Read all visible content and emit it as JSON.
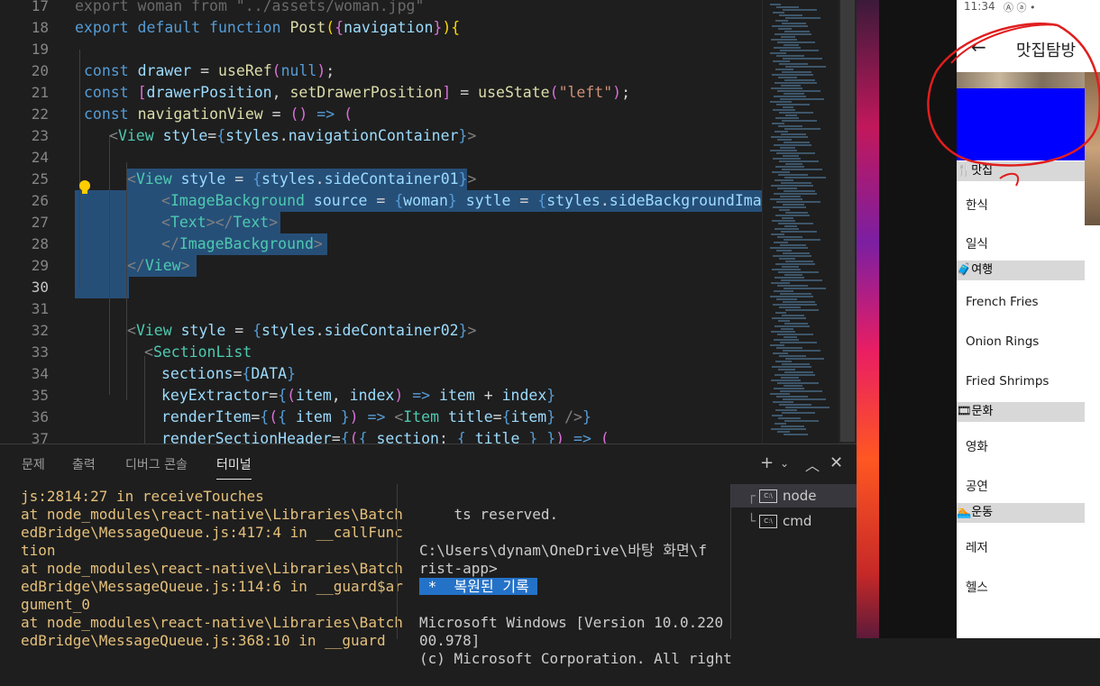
{
  "editor": {
    "line_numbers": [
      "17",
      "18",
      "19",
      "20",
      "21",
      "22",
      "23",
      "24",
      "25",
      "26",
      "27",
      "28",
      "29",
      "30",
      "31",
      "32",
      "33",
      "34",
      "35",
      "36",
      "37"
    ],
    "active_line": "30",
    "lines": {
      "l17": "export woman from \"../assets/woman.jpg\"",
      "l18": [
        [
          "export ",
          "kw"
        ],
        [
          "default ",
          "kw"
        ],
        [
          "function ",
          "kw"
        ],
        [
          "Post",
          "fn"
        ],
        [
          "(",
          "br"
        ],
        [
          "{",
          "br2"
        ],
        [
          "navigation",
          "var"
        ],
        [
          "}",
          "br2"
        ],
        [
          ")",
          "br"
        ],
        [
          "{",
          "br"
        ]
      ],
      "l20": [
        [
          "const ",
          "kw"
        ],
        [
          "drawer",
          "var"
        ],
        [
          " = ",
          ""
        ],
        [
          "useRef",
          "fn"
        ],
        [
          "(",
          "br2"
        ],
        [
          "null",
          "kw"
        ],
        [
          ")",
          "br2"
        ],
        [
          ";",
          ""
        ]
      ],
      "l21": [
        [
          "const ",
          "kw"
        ],
        [
          "[",
          "br2"
        ],
        [
          "drawerPosition",
          "var"
        ],
        [
          ", ",
          ""
        ],
        [
          "setDrawerPosition",
          "fn"
        ],
        [
          "]",
          "br2"
        ],
        [
          " = ",
          ""
        ],
        [
          "useState",
          "fn"
        ],
        [
          "(",
          "br2"
        ],
        [
          "\"left\"",
          "str"
        ],
        [
          ")",
          "br2"
        ],
        [
          ";",
          ""
        ]
      ],
      "l22": [
        [
          "const ",
          "kw"
        ],
        [
          "navigationView",
          "fn"
        ],
        [
          " = ",
          ""
        ],
        [
          "()",
          "br2"
        ],
        [
          " => ",
          "kw"
        ],
        [
          "(",
          "br2"
        ]
      ],
      "l23": [
        [
          "<",
          "pun"
        ],
        [
          "View ",
          "tag"
        ],
        [
          "style",
          "var"
        ],
        [
          "=",
          ""
        ],
        [
          "{",
          "kw"
        ],
        [
          "styles",
          "var"
        ],
        [
          ".",
          ""
        ],
        [
          "navigationContainer",
          "var"
        ],
        [
          "}",
          "kw"
        ],
        [
          ">",
          "pun"
        ]
      ],
      "l25": [
        [
          "<",
          "pun"
        ],
        [
          "View ",
          "tag"
        ],
        [
          "style",
          "var"
        ],
        [
          " = ",
          ""
        ],
        [
          "{",
          "kw"
        ],
        [
          "styles",
          "var"
        ],
        [
          ".",
          ""
        ],
        [
          "sideContainer01",
          "var"
        ],
        [
          "}",
          "kw"
        ],
        [
          ">",
          "pun"
        ]
      ],
      "l26": [
        [
          "<",
          "pun"
        ],
        [
          "ImageBackground ",
          "tag"
        ],
        [
          "source",
          "var"
        ],
        [
          " = ",
          ""
        ],
        [
          "{",
          "kw"
        ],
        [
          "woman",
          "var"
        ],
        [
          "}",
          "kw"
        ],
        [
          " sytle",
          "var"
        ],
        [
          " = ",
          ""
        ],
        [
          "{",
          "kw"
        ],
        [
          "styles",
          "var"
        ],
        [
          ".",
          ""
        ],
        [
          "sideBackgroundImage",
          "var"
        ]
      ],
      "l27": [
        [
          "<",
          "pun"
        ],
        [
          "Text",
          "tag"
        ],
        [
          "></",
          "pun"
        ],
        [
          "Text",
          "tag"
        ],
        [
          ">",
          "pun"
        ]
      ],
      "l28": [
        [
          "</",
          "pun"
        ],
        [
          "ImageBackground",
          "tag"
        ],
        [
          ">",
          "pun"
        ]
      ],
      "l29": [
        [
          "</",
          "pun"
        ],
        [
          "View",
          "tag"
        ],
        [
          ">",
          "pun"
        ]
      ],
      "l32": [
        [
          "<",
          "pun"
        ],
        [
          "View ",
          "tag"
        ],
        [
          "style",
          "var"
        ],
        [
          " = ",
          ""
        ],
        [
          "{",
          "kw"
        ],
        [
          "styles",
          "var"
        ],
        [
          ".",
          ""
        ],
        [
          "sideContainer02",
          "var"
        ],
        [
          "}",
          "kw"
        ],
        [
          ">",
          "pun"
        ]
      ],
      "l33": [
        [
          "<",
          "pun"
        ],
        [
          "SectionList",
          "tag"
        ]
      ],
      "l34": [
        [
          "sections",
          "var"
        ],
        [
          "=",
          ""
        ],
        [
          "{",
          "kw"
        ],
        [
          "DATA",
          "var"
        ],
        [
          "}",
          "kw"
        ]
      ],
      "l35": [
        [
          "keyExtractor",
          "var"
        ],
        [
          "=",
          ""
        ],
        [
          "{",
          "kw"
        ],
        [
          "(",
          "br2"
        ],
        [
          "item",
          "var"
        ],
        [
          ", ",
          ""
        ],
        [
          "index",
          "var"
        ],
        [
          ")",
          "br2"
        ],
        [
          " => ",
          "kw"
        ],
        [
          "item",
          "var"
        ],
        [
          " + ",
          ""
        ],
        [
          "index",
          "var"
        ],
        [
          "}",
          "kw"
        ]
      ],
      "l36": [
        [
          "renderItem",
          "var"
        ],
        [
          "=",
          ""
        ],
        [
          "{",
          "kw"
        ],
        [
          "(",
          "br2"
        ],
        [
          "{ ",
          "kw"
        ],
        [
          "item",
          "var"
        ],
        [
          " }",
          "kw"
        ],
        [
          ")",
          "br2"
        ],
        [
          " => ",
          "kw"
        ],
        [
          "<",
          "pun"
        ],
        [
          "Item ",
          "tag"
        ],
        [
          "title",
          "var"
        ],
        [
          "=",
          ""
        ],
        [
          "{",
          "kw"
        ],
        [
          "item",
          "var"
        ],
        [
          "}",
          "kw"
        ],
        [
          " />",
          "pun"
        ],
        [
          "}",
          "kw"
        ]
      ],
      "l37": [
        [
          "renderSectionHeader",
          "var"
        ],
        [
          "=",
          ""
        ],
        [
          "{",
          "kw"
        ],
        [
          "(",
          "br2"
        ],
        [
          "{ ",
          "kw"
        ],
        [
          "section",
          "var"
        ],
        [
          ": ",
          ""
        ],
        [
          "{ ",
          "kw"
        ],
        [
          "title",
          "var"
        ],
        [
          " }",
          "kw"
        ],
        [
          " }",
          "kw"
        ],
        [
          ")",
          "br2"
        ],
        [
          " => ",
          "kw"
        ],
        [
          "(",
          "br2"
        ]
      ]
    }
  },
  "panel": {
    "tabs": [
      "문제",
      "출력",
      "디버그 콘솔",
      "터미널"
    ],
    "active_tab": "터미널",
    "left_output": "js:2814:27 in receiveTouches\nat node_modules\\react-native\\Libraries\\Batch\nedBridge\\MessageQueue.js:417:4 in __callFunc\ntion\nat node_modules\\react-native\\Libraries\\Batch\nedBridge\\MessageQueue.js:114:6 in __guard$ar\ngument_0\nat node_modules\\react-native\\Libraries\\Batch\nedBridge\\MessageQueue.js:368:10 in __guard",
    "right_output_1": "ts reserved.\n\nC:\\Users\\dynam\\OneDrive\\바탕 화면\\f\nrist-app>",
    "restored": " *  복원된 기록 ",
    "right_output_2": "\nMicrosoft Windows [Version 10.0.220\n00.978]\n(c) Microsoft Corporation. All right",
    "terminals": [
      "node",
      "cmd"
    ],
    "cmd_glyph": "C:\\"
  },
  "phone": {
    "status_time": "11:34",
    "status_icons": "Ⓐ  ⓐ  •",
    "title": "맛집탐방",
    "back_arrow": "←",
    "sections": [
      {
        "header": "맛집",
        "icon": "🍴",
        "items": [
          "한식",
          "일식"
        ]
      },
      {
        "header": "여행",
        "icon": "🧳",
        "items": [
          "French Fries",
          "Onion Rings",
          "Fried Shrimps"
        ]
      },
      {
        "header": "문화",
        "icon": "🎞",
        "items": [
          "영화",
          "공연"
        ]
      },
      {
        "header": "운동",
        "icon": "🏊",
        "items": [
          "레저",
          "헬스"
        ]
      }
    ]
  },
  "colors": {
    "editor_bg": "#1e1e1e",
    "selection": "#264f78",
    "drawer_blue": "#0000ff",
    "annotation_red": "#e01e1e"
  }
}
